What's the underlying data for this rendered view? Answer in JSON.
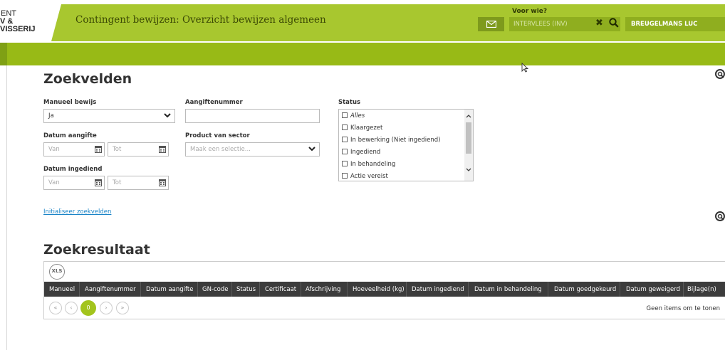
{
  "header": {
    "brand_line1": "ENT",
    "brand_line2": "V & VISSERIJ",
    "title": "Contingent bewijzen: Overzicht bewijzen algemeen",
    "voor_wie_label": "Voor wie?",
    "voor_wie_value": "INTERVLEES (INV)",
    "user_name": "BREUGELMANS LUC"
  },
  "search": {
    "title": "Zoekvelden",
    "manueel_label": "Manueel bewijs",
    "manueel_value": "Ja",
    "aangiftenummer_label": "Aangiftenummer",
    "aangiftenummer_value": "",
    "datum_aangifte_label": "Datum aangifte",
    "datum_ingediend_label": "Datum ingediend",
    "van_placeholder": "Van",
    "tot_placeholder": "Tot",
    "product_label": "Product van sector",
    "product_placeholder": "Maak een selectie...",
    "status_label": "Status",
    "status_items": [
      "Alles",
      "Klaargezet",
      "In bewerking (Niet ingediend)",
      "Ingediend",
      "In behandeling",
      "Actie vereist"
    ],
    "init_link": "Initialiseer zoekvelden"
  },
  "results": {
    "title": "Zoekresultaat",
    "xls_label": "XLS",
    "columns": [
      "Manueel",
      "Aangiftenummer",
      "Datum aangifte",
      "GN-code",
      "Status",
      "Certificaat",
      "Afschrijving",
      "Hoeveelheid (kg)",
      "Datum ingediend",
      "Datum in behandeling",
      "Datum goedgekeurd",
      "Datum geweigerd",
      "Bijlage(n)"
    ],
    "pager": {
      "first": "«",
      "prev": "‹",
      "current": "0",
      "next": "›",
      "last": "»"
    },
    "empty_text": "Geen items om te tonen"
  },
  "colors": {
    "accent_green": "#a8c72f",
    "sub_bar_green": "#98ba16",
    "header_dark": "#3c3c3c",
    "link_blue": "#1a84c7"
  },
  "icons": [
    "mail-icon",
    "clear-icon",
    "search-icon",
    "chevron-down-icon",
    "calendar-icon",
    "zoom-icon",
    "mouse-cursor-icon"
  ]
}
